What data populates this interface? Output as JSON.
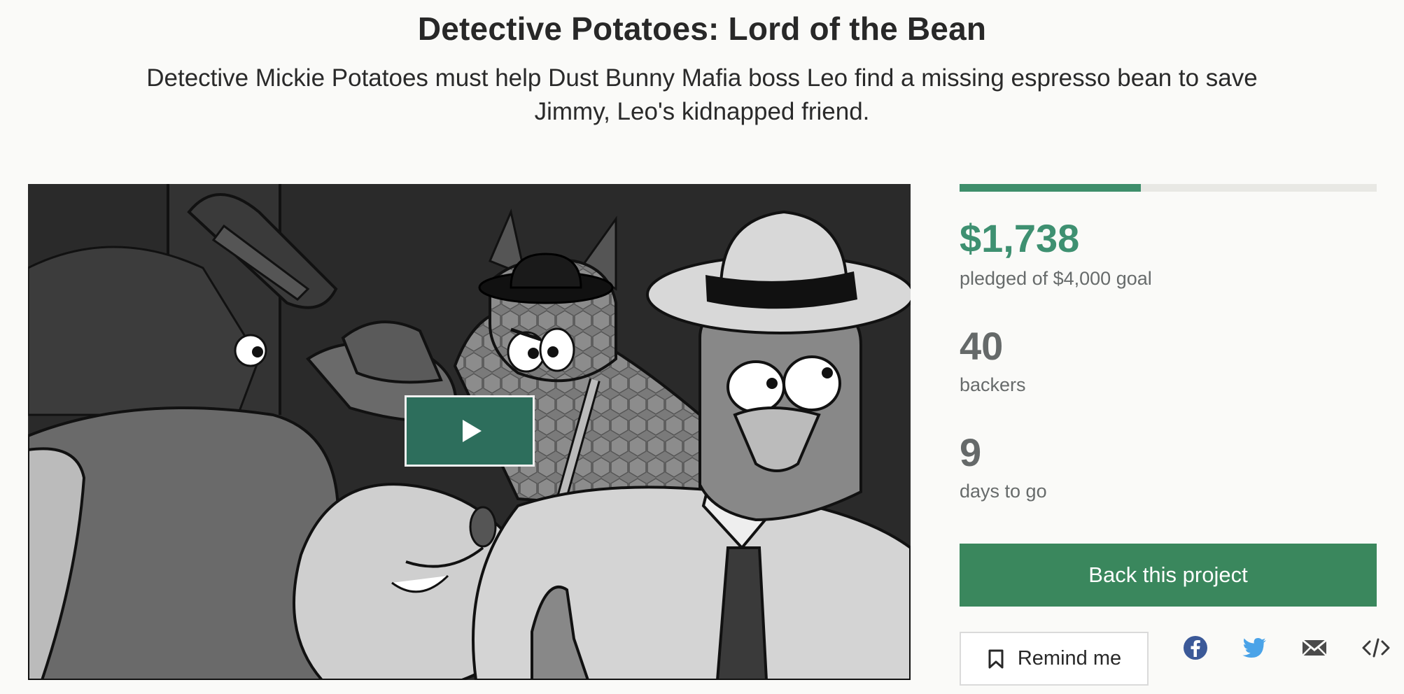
{
  "project": {
    "title": "Detective Potatoes: Lord of the Bean",
    "blurb": "Detective Mickie Potatoes must help Dust Bunny Mafia boss Leo find a missing espresso bean to save Jimmy, Leo's kidnapped friend."
  },
  "video": {
    "play_icon": "play-icon"
  },
  "funding": {
    "pledged": "$1,738",
    "pledged_label": "pledged of $4,000 goal",
    "progress_fraction": 0.4345,
    "backers": "40",
    "backers_label": "backers",
    "days": "9",
    "days_label": "days to go"
  },
  "actions": {
    "back_label": "Back this project",
    "remind_label": "Remind me",
    "remind_icon": "bookmark-icon",
    "share_icons": [
      "facebook-icon",
      "twitter-icon",
      "email-icon",
      "embed-icon"
    ]
  },
  "colors": {
    "accent_green": "#3e9071",
    "button_green": "#3a875d",
    "play_button": "#2d6e5c",
    "facebook": "#3b5998",
    "twitter": "#4aa3e8"
  }
}
